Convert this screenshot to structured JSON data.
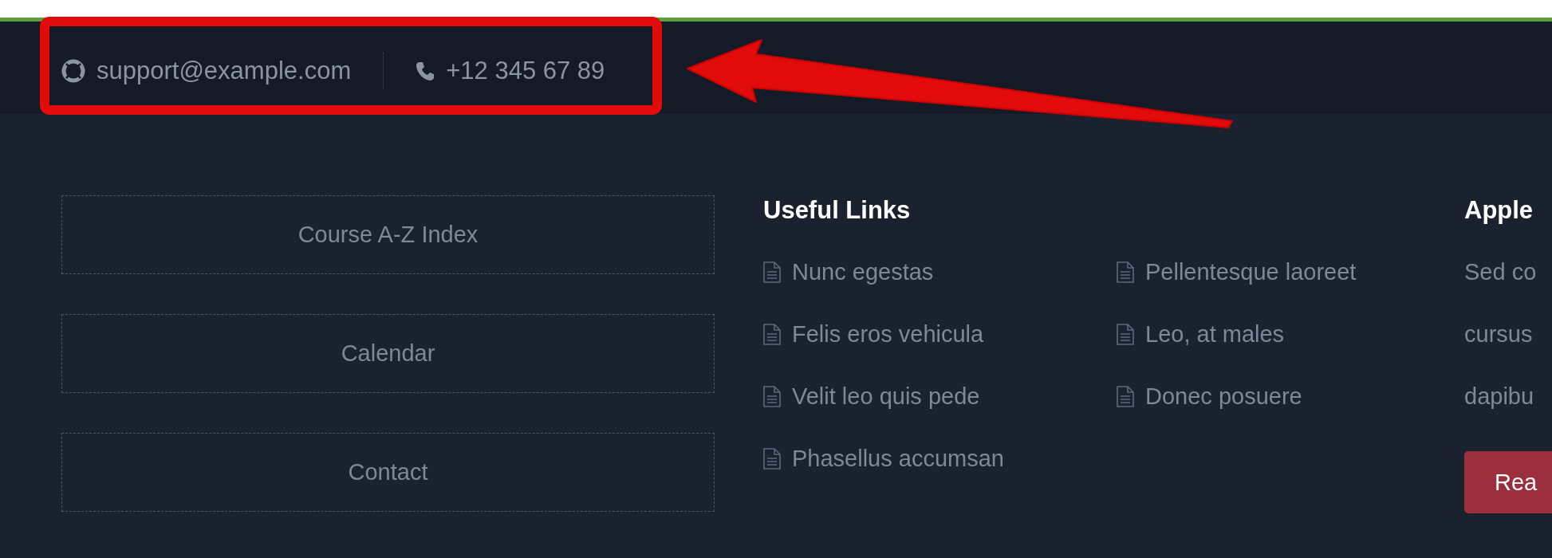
{
  "top_bar": {
    "email": "support@example.com",
    "phone": "+12 345 67 89"
  },
  "quick_links": [
    "Course A-Z Index",
    "Calendar",
    "Contact"
  ],
  "useful_links": {
    "title": "Useful Links",
    "columns": [
      [
        "Nunc egestas",
        "Felis eros vehicula",
        "Velit leo quis pede",
        "Phasellus accumsan"
      ],
      [
        "Pellentesque laoreet",
        "Leo, at males",
        "Donec posuere"
      ]
    ]
  },
  "apple_section": {
    "title": "Apple",
    "paragraph_lines": [
      "Sed co",
      "cursus",
      "dapibu"
    ],
    "button": "Rea"
  }
}
